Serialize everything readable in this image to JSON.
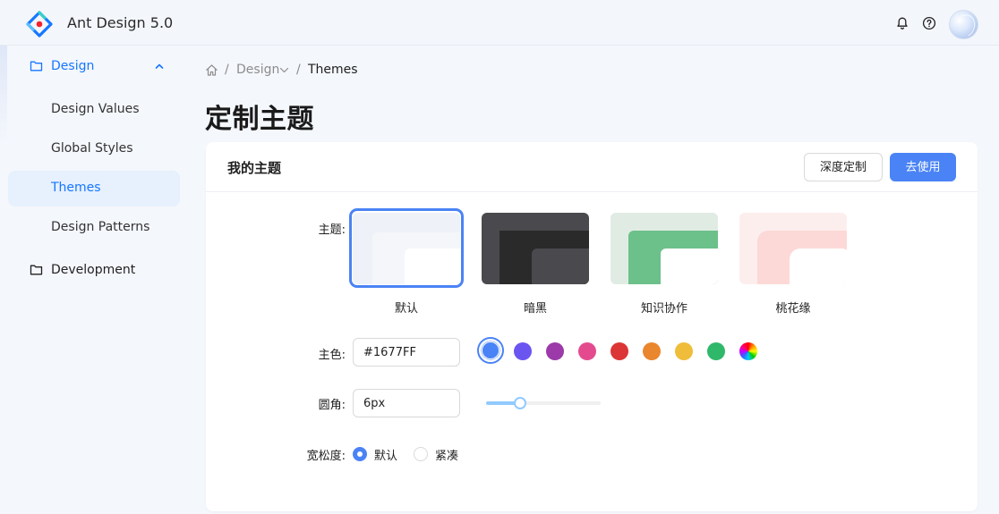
{
  "header": {
    "app_title": "Ant Design 5.0",
    "icons": [
      "logo-icon",
      "bell-icon",
      "help-icon",
      "avatar"
    ]
  },
  "sidebar": {
    "groups": [
      {
        "label": "Design",
        "icon": "folder-icon",
        "expanded": true,
        "items": [
          {
            "label": "Design Values",
            "active": false
          },
          {
            "label": "Global Styles",
            "active": false
          },
          {
            "label": "Themes",
            "active": true
          },
          {
            "label": "Design Patterns",
            "active": false
          }
        ]
      },
      {
        "label": "Development",
        "icon": "folder-icon",
        "expanded": false
      }
    ]
  },
  "breadcrumb": {
    "separator": "/",
    "items": [
      "Design",
      "Themes"
    ]
  },
  "page": {
    "title": "定制主题"
  },
  "card": {
    "title": "我的主题",
    "custom_button": "深度定制",
    "use_button": "去使用",
    "theme_label": "主题:",
    "themes": [
      {
        "label": "默认",
        "selected": true
      },
      {
        "label": "暗黑",
        "selected": false
      },
      {
        "label": "知识协作",
        "selected": false
      },
      {
        "label": "桃花缘",
        "selected": false
      }
    ],
    "color_label": "主色:",
    "color_value": "#1677FF",
    "color_swatches": [
      "#4a83f5",
      "#6b55f0",
      "#9b3aa8",
      "#e44b8f",
      "#dc3535",
      "#ea862d",
      "#efbd3a",
      "#2fb86a",
      "rainbow"
    ],
    "radius_label": "圆角:",
    "radius_value": "6px",
    "radius_slider_fraction": 0.3,
    "density_label": "宽松度:",
    "density_options": [
      {
        "label": "默认",
        "checked": true
      },
      {
        "label": "紧凑",
        "checked": false
      }
    ]
  },
  "colors": {
    "primary": "#4a83f5",
    "active_nav_bg": "#e7f0fd",
    "page_bg": "#f4f7fc"
  }
}
